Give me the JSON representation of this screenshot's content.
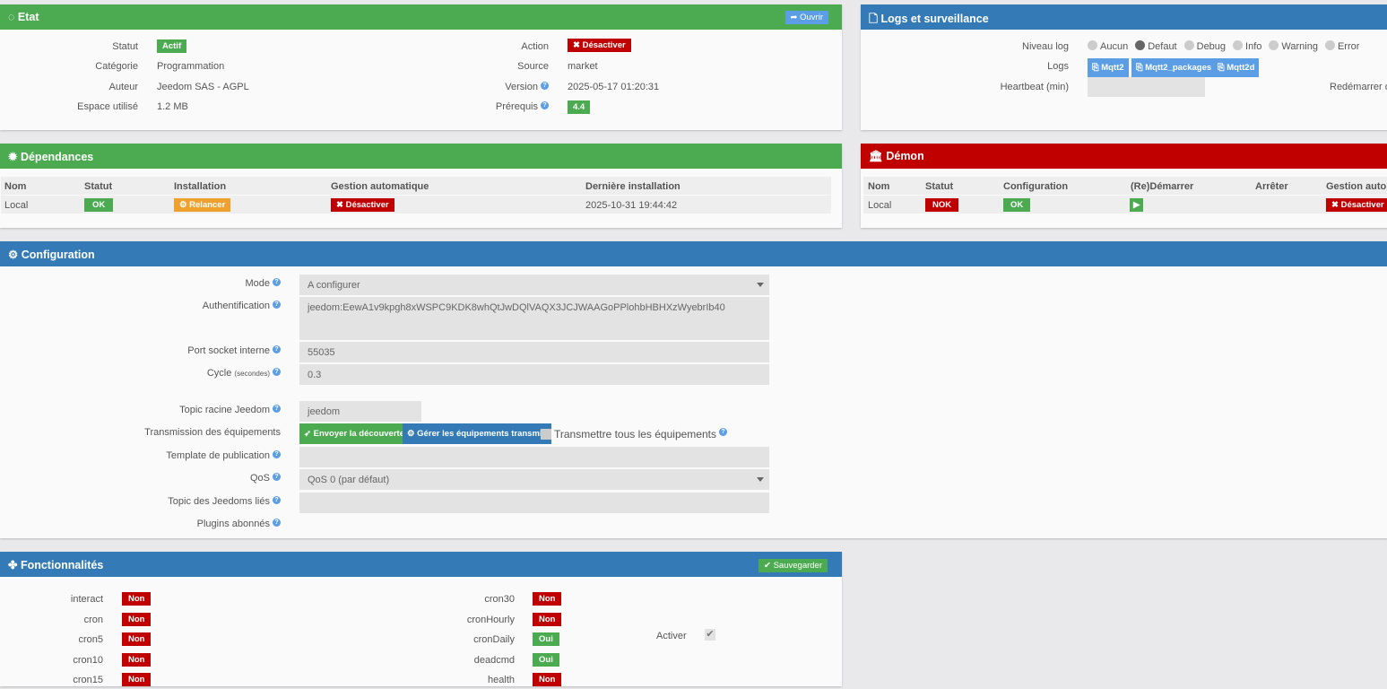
{
  "etat": {
    "title": "Etat",
    "open": "Ouvrir",
    "left": [
      {
        "label": "Statut",
        "value": "Actif"
      },
      {
        "label": "Catégorie",
        "value": "Programmation"
      },
      {
        "label": "Auteur",
        "value": "Jeedom SAS - AGPL"
      },
      {
        "label": "Espace utilisé",
        "value": "1.2 MB"
      }
    ],
    "right": [
      {
        "label": "Action",
        "value": "Désactiver"
      },
      {
        "label": "Source",
        "value": "market"
      },
      {
        "label": "Version",
        "value": "2025-05-17 01:20:31"
      },
      {
        "label": "Prérequis",
        "value": "4.4"
      }
    ]
  },
  "logs": {
    "title": "Logs et surveillance",
    "level_label": "Niveau log",
    "levels": [
      "Aucun",
      "Defaut",
      "Debug",
      "Info",
      "Warning",
      "Error"
    ],
    "selected_level": "Defaut",
    "logs_label": "Logs",
    "log_buttons": [
      "Mqtt2",
      "Mqtt2_packages",
      "Mqtt2d"
    ],
    "heartbeat_label": "Heartbeat (min)",
    "heartbeat_value": "",
    "restart_label": "Redémarrer d"
  },
  "deps": {
    "title": "Dépendances",
    "headers": [
      "Nom",
      "Statut",
      "Installation",
      "Gestion automatique",
      "Dernière installation"
    ],
    "row": {
      "name": "Local",
      "status": "OK",
      "install": "Relancer",
      "auto": "Désactiver",
      "last": "2025-10-31 19:44:42"
    }
  },
  "demon": {
    "title": "Démon",
    "headers": [
      "Nom",
      "Statut",
      "Configuration",
      "(Re)Démarrer",
      "Arrêter",
      "Gestion autom"
    ],
    "row": {
      "name": "Local",
      "status": "NOK",
      "config": "OK",
      "auto": "Désactiver"
    }
  },
  "config": {
    "title": "Configuration",
    "mode_label": "Mode",
    "mode_value": "A configurer",
    "auth_label": "Authentification",
    "auth_value": "jeedom:EewA1v9kpgh8xWSPC9KDK8whQtJwDQlVAQX3JCJWAAGoPPlohbHBHXzWyebrIb40",
    "port_label": "Port socket interne",
    "port_value": "55035",
    "cycle_label": "Cycle",
    "cycle_unit": "(secondes)",
    "cycle_value": "0.3",
    "topic_label": "Topic racine Jeedom",
    "topic_value": "jeedom",
    "trans_label": "Transmission des équipements",
    "send_btn": "Envoyer la découverte",
    "manage_btn": "Gérer les équipements transmis",
    "all_label": "Transmettre tous les équipements",
    "template_label": "Template de publication",
    "template_value": "",
    "qos_label": "QoS",
    "qos_value": "QoS 0 (par défaut)",
    "linked_label": "Topic des Jeedoms liés",
    "linked_value": "",
    "plugins_label": "Plugins abonnés"
  },
  "func": {
    "title": "Fonctionnalités",
    "save": "Sauvegarder",
    "left": [
      {
        "label": "interact",
        "value": "Non"
      },
      {
        "label": "cron",
        "value": "Non"
      },
      {
        "label": "cron5",
        "value": "Non"
      },
      {
        "label": "cron10",
        "value": "Non"
      },
      {
        "label": "cron15",
        "value": "Non"
      }
    ],
    "right": [
      {
        "label": "cron30",
        "value": "Non"
      },
      {
        "label": "cronHourly",
        "value": "Non"
      },
      {
        "label": "cronDaily",
        "value": "Oui"
      },
      {
        "label": "deadcmd",
        "value": "Oui"
      },
      {
        "label": "health",
        "value": "Non"
      }
    ],
    "activate_label": "Activer",
    "activate_checked": true
  },
  "colors": {
    "green": "#4cab50",
    "blue": "#337ab7",
    "red": "#c00000",
    "orange": "#f0a12d"
  }
}
